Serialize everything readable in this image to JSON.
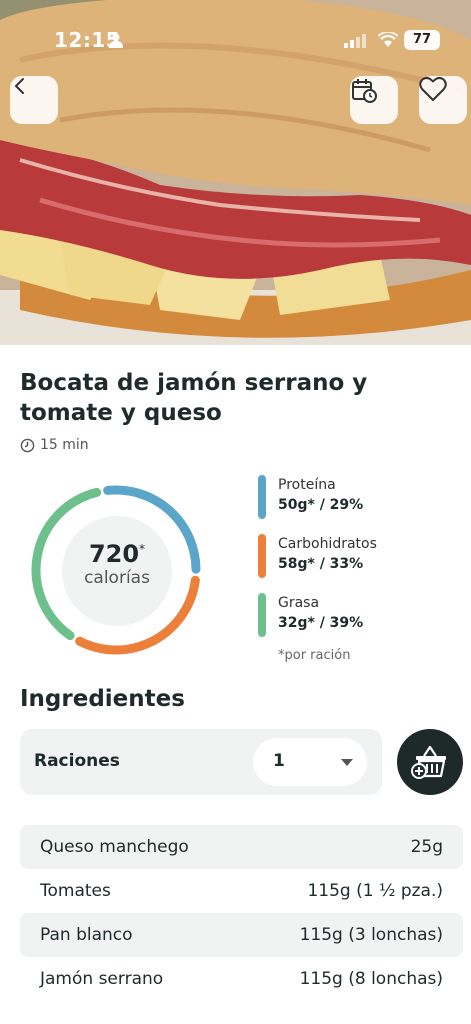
{
  "status_bar": {
    "time": "12:15",
    "battery": "77"
  },
  "header": {
    "icons": [
      "back-chevron-icon",
      "calendar-clock-icon",
      "heart-icon"
    ]
  },
  "recipe": {
    "title": "Bocata de jamón serrano y tomate y queso",
    "time": "15 min"
  },
  "nutrition": {
    "calories_value": "720",
    "calories_mark": "*",
    "calories_label": "calorías",
    "macros": [
      {
        "name": "Proteína",
        "value": "50g* / 29%",
        "color": "#5aa5c9",
        "fraction": 0.29
      },
      {
        "name": "Carbohidratos",
        "value": "58g* / 33%",
        "color": "#ec7f3a",
        "fraction": 0.33
      },
      {
        "name": "Grasa",
        "value": "32g* / 39%",
        "color": "#6dc08c",
        "fraction": 0.39
      }
    ],
    "note": "*por ración"
  },
  "ingredients": {
    "heading": "Ingredientes",
    "servings_label": "Raciones",
    "servings_value": "1",
    "items": [
      {
        "name": "Queso manchego",
        "qty": "25g"
      },
      {
        "name": "Tomates",
        "qty": "115g (1 ½ pza.)"
      },
      {
        "name": "Pan blanco",
        "qty": "115g (3 lonchas)"
      },
      {
        "name": "Jamón serrano",
        "qty": "115g (8 lonchas)"
      }
    ]
  }
}
